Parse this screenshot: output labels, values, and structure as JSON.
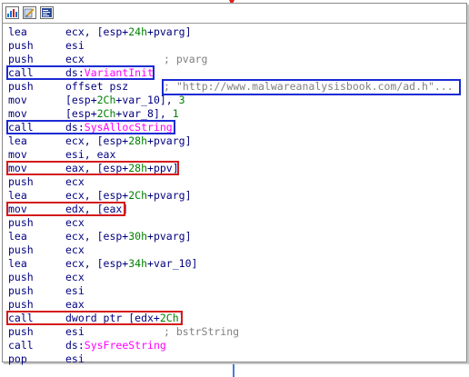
{
  "title_icons": [
    "graph-view-icon",
    "edit-node-icon",
    "code-view-icon"
  ],
  "colors": {
    "mnemonic": "#000080",
    "number": "#008000",
    "import": "#ff00ff",
    "comment": "#808080",
    "highlight_blue": "#1a2bd4",
    "highlight_red": "#d41a1a"
  },
  "lines": [
    {
      "mn": "lea",
      "op_a": "ecx, [esp+",
      "op_num": "24h",
      "op_b": "+pvarg]",
      "comment": ""
    },
    {
      "mn": "push",
      "op_a": "esi",
      "op_num": "",
      "op_b": "",
      "comment": ""
    },
    {
      "mn": "push",
      "op_a": "ecx",
      "op_num": "",
      "op_b": "",
      "comment": "; pvarg"
    },
    {
      "mn": "call",
      "op_a": "ds:",
      "op_imp": "VariantInit",
      "comment": ""
    },
    {
      "mn": "push",
      "op_a": "offset psz",
      "comment": "; ",
      "string": "\"http://www.malwareanalysisbook.com/ad.h\"..."
    },
    {
      "mn": "mov",
      "op_a": "[esp+",
      "op_num": "2Ch",
      "op_b": "+var_10], ",
      "op_num2": "3",
      "comment": ""
    },
    {
      "mn": "mov",
      "op_a": "[esp+",
      "op_num": "2Ch",
      "op_b": "+var_8], ",
      "op_num2": "1",
      "comment": ""
    },
    {
      "mn": "call",
      "op_a": "ds:",
      "op_imp": "SysAllocString",
      "comment": ""
    },
    {
      "mn": "lea",
      "op_a": "ecx, [esp+",
      "op_num": "28h",
      "op_b": "+pvarg]",
      "comment": ""
    },
    {
      "mn": "mov",
      "op_a": "esi, eax",
      "op_num": "",
      "op_b": "",
      "comment": ""
    },
    {
      "mn": "mov",
      "op_a": "eax, [esp+",
      "op_num": "28h",
      "op_b": "+ppv]",
      "comment": ""
    },
    {
      "mn": "push",
      "op_a": "ecx",
      "op_num": "",
      "op_b": "",
      "comment": ""
    },
    {
      "mn": "lea",
      "op_a": "ecx, [esp+",
      "op_num": "2Ch",
      "op_b": "+pvarg]",
      "comment": ""
    },
    {
      "mn": "mov",
      "op_a": "edx, [eax]",
      "op_num": "",
      "op_b": "",
      "comment": ""
    },
    {
      "mn": "push",
      "op_a": "ecx",
      "op_num": "",
      "op_b": "",
      "comment": ""
    },
    {
      "mn": "lea",
      "op_a": "ecx, [esp+",
      "op_num": "30h",
      "op_b": "+pvarg]",
      "comment": ""
    },
    {
      "mn": "push",
      "op_a": "ecx",
      "op_num": "",
      "op_b": "",
      "comment": ""
    },
    {
      "mn": "lea",
      "op_a": "ecx, [esp+",
      "op_num": "34h",
      "op_b": "+var_10]",
      "comment": ""
    },
    {
      "mn": "push",
      "op_a": "ecx",
      "op_num": "",
      "op_b": "",
      "comment": ""
    },
    {
      "mn": "push",
      "op_a": "esi",
      "op_num": "",
      "op_b": "",
      "comment": ""
    },
    {
      "mn": "push",
      "op_a": "eax",
      "op_num": "",
      "op_b": "",
      "comment": ""
    },
    {
      "mn": "call",
      "op_a": "dword ptr [edx+",
      "op_num": "2Ch",
      "op_b": "]",
      "comment": ""
    },
    {
      "mn": "push",
      "op_a": "esi",
      "op_num": "",
      "op_b": "",
      "comment": "; bstrString"
    },
    {
      "mn": "call",
      "op_a": "ds:",
      "op_imp": "SysFreeString",
      "comment": ""
    },
    {
      "mn": "pop",
      "op_a": "esi",
      "op_num": "",
      "op_b": "",
      "comment": ""
    }
  ],
  "highlights": [
    {
      "line": 3,
      "color": "blue",
      "target": "call-variantinit"
    },
    {
      "line": 4,
      "color": "blue",
      "target": "url-string"
    },
    {
      "line": 7,
      "color": "blue",
      "target": "call-sysallocstring"
    },
    {
      "line": 10,
      "color": "red",
      "target": "mov-eax-ppv"
    },
    {
      "line": 13,
      "color": "red",
      "target": "mov-edx-eax"
    },
    {
      "line": 21,
      "color": "red",
      "target": "call-edx-2ch"
    }
  ]
}
